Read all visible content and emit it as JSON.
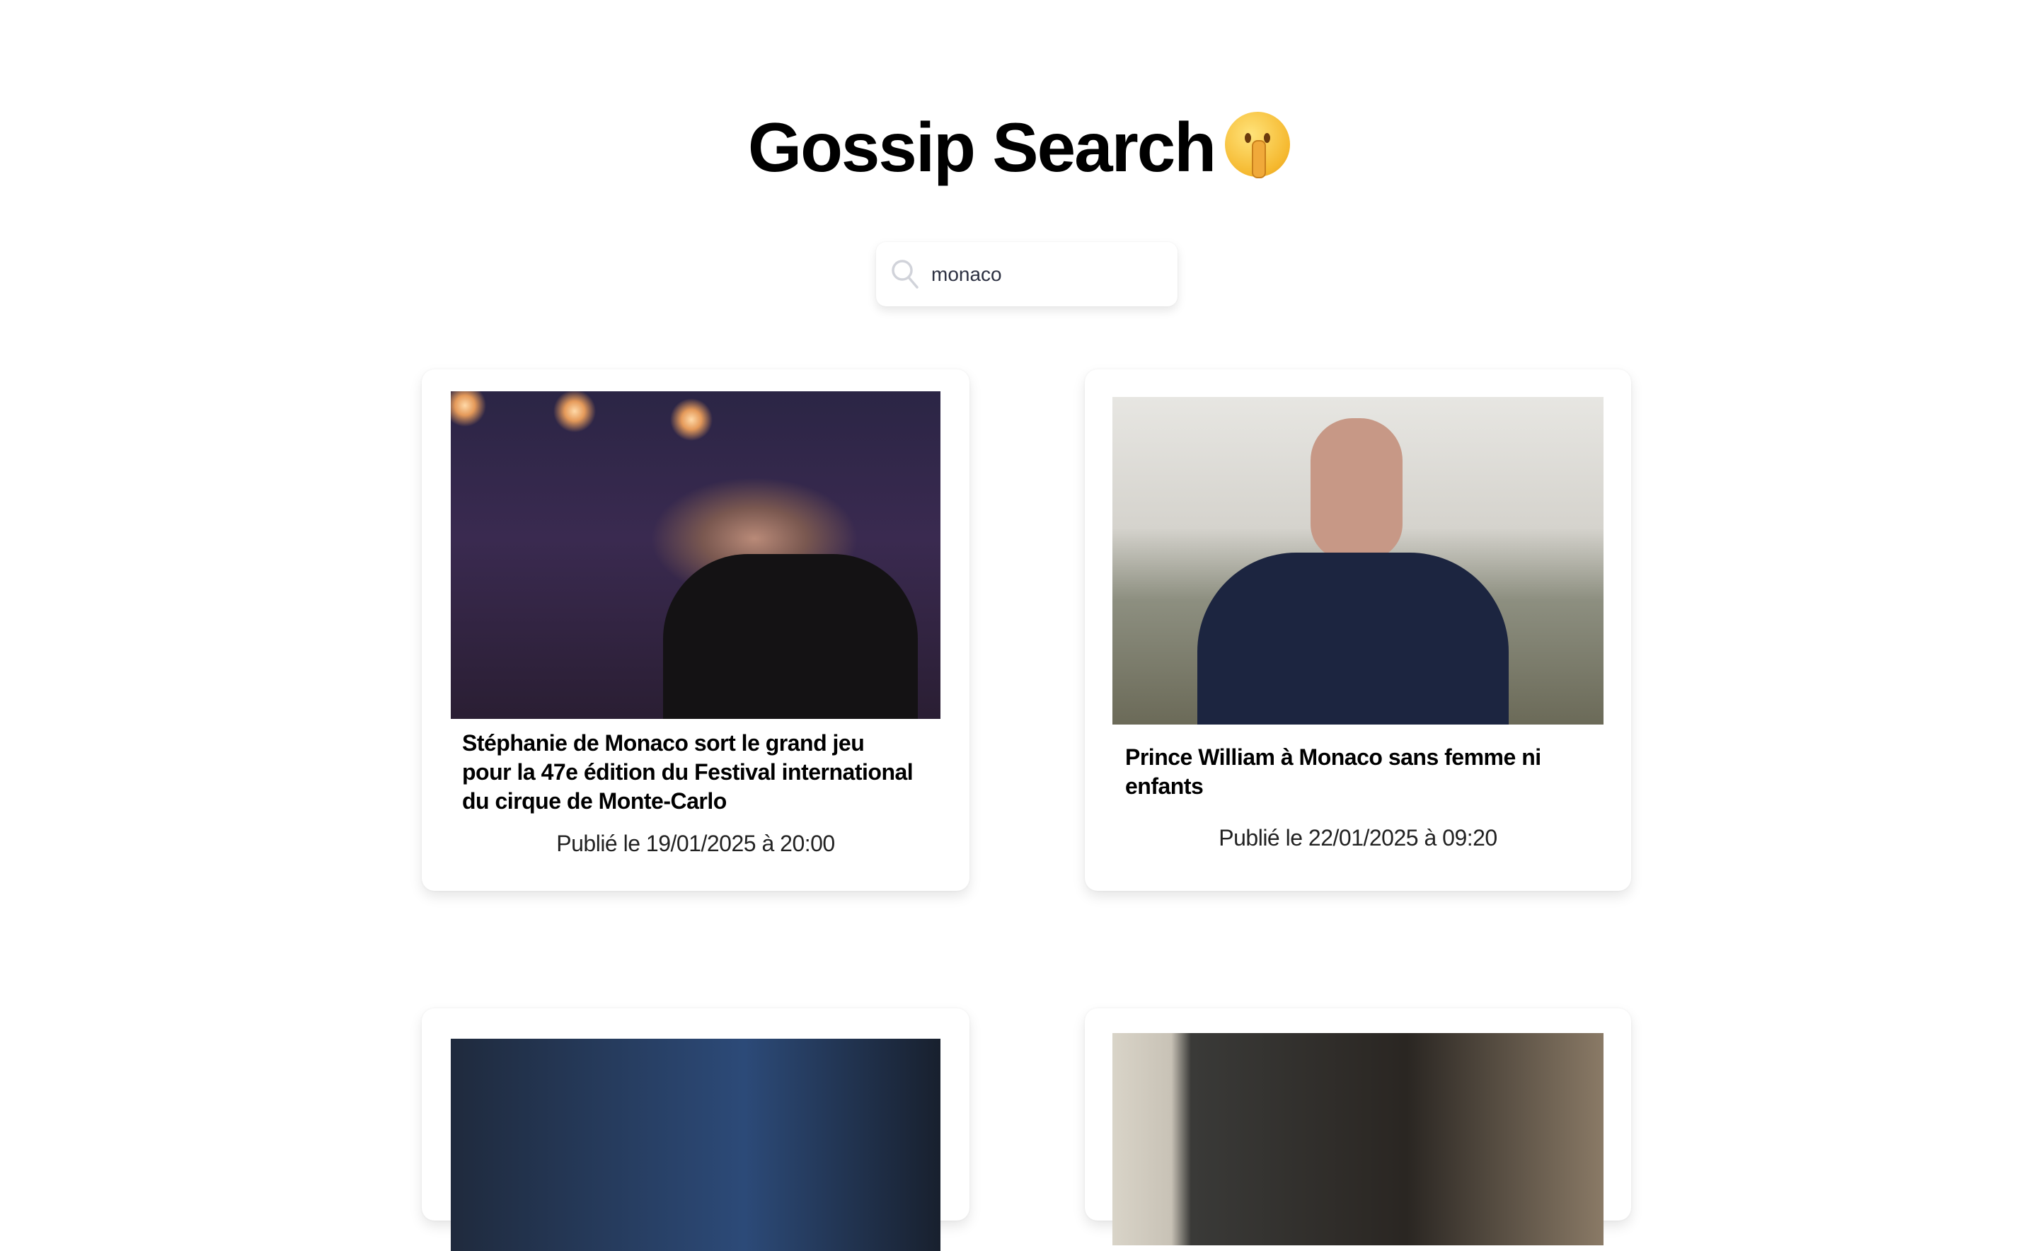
{
  "header": {
    "title": "Gossip Search",
    "emoji": "shushing-face"
  },
  "search": {
    "value": "monaco",
    "icon": "search-icon"
  },
  "articles": [
    {
      "title": "Stéphanie de Monaco sort le grand jeu pour la 47e édition du Festival international du cirque de Monte-Carlo",
      "date": "Publié le 19/01/2025 à 20:00"
    },
    {
      "title": "Prince William à Monaco sans femme ni enfants",
      "date": "Publié le 22/01/2025 à 09:20"
    }
  ]
}
